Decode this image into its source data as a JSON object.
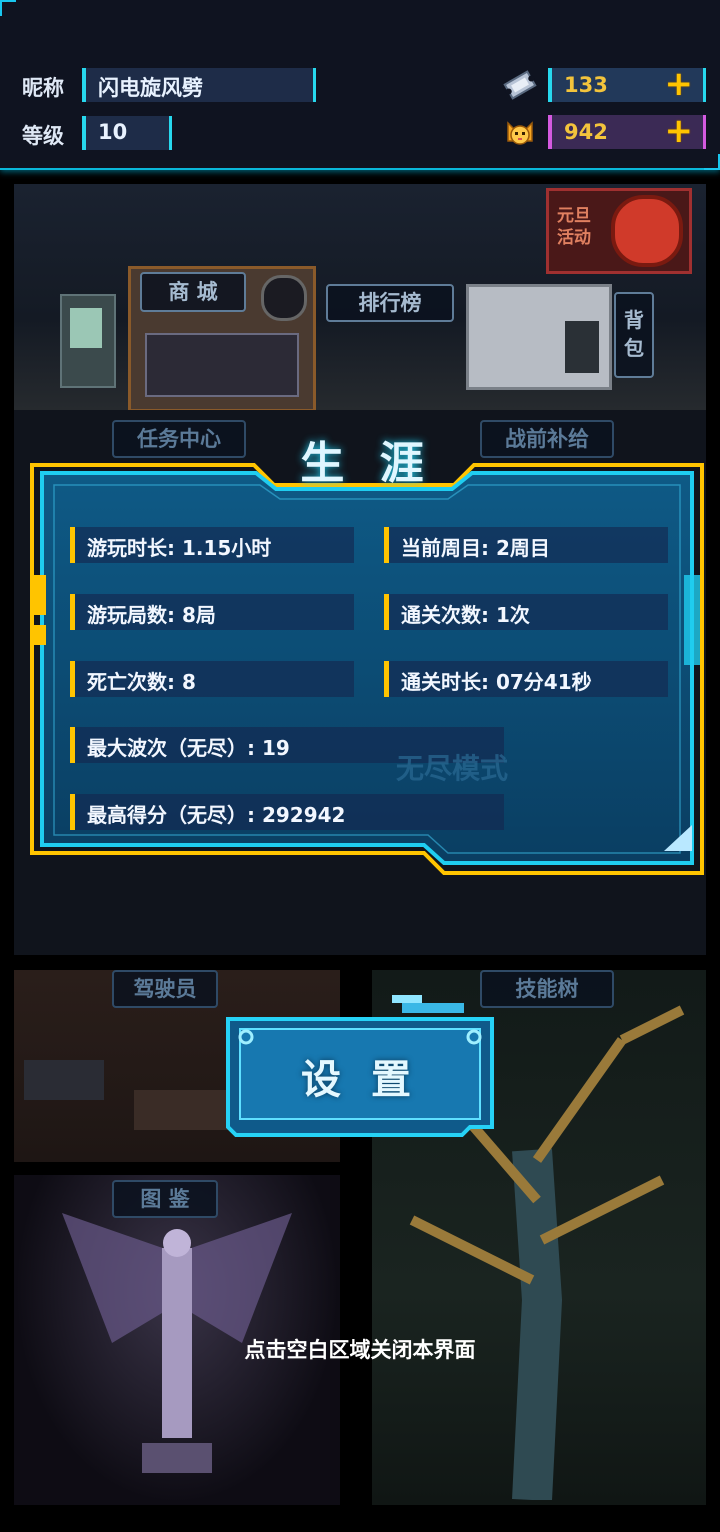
{
  "profile": {
    "nickname_label": "昵称",
    "nickname_value": "闪电旋风劈",
    "level_label": "等级",
    "level_value": "10",
    "currency_ticket": "133",
    "currency_coin": "942",
    "ticket_icon": "ticket-icon",
    "coin_icon": "cat-coin-icon"
  },
  "rooms": {
    "event_label": "元旦活动",
    "shop": "商 城",
    "ranking": "排行榜",
    "backpack": "背包",
    "missions": "任务中心",
    "supply": "战前补给",
    "endless": "无尽模式",
    "pilot": "驾驶员",
    "skill_tree": "技能树",
    "codex": "图 鉴"
  },
  "career": {
    "title": "生 涯",
    "stats": [
      {
        "text": "游玩时长: 1.15小时"
      },
      {
        "text": "当前周目: 2周目"
      },
      {
        "text": "游玩局数: 8局"
      },
      {
        "text": "通关次数: 1次"
      },
      {
        "text": "死亡次数: 8"
      },
      {
        "text": "通关时长: 07分41秒"
      },
      {
        "text": "最大波次（无尽）: 19"
      },
      {
        "text": "最高得分（无尽）: 292942"
      }
    ]
  },
  "settings_label": "设 置",
  "close_hint": "点击空白区域关闭本界面",
  "colors": {
    "accent_cyan": "#19c6ee",
    "accent_gold": "#ffc400",
    "panel_blue": "#0e4f78"
  }
}
